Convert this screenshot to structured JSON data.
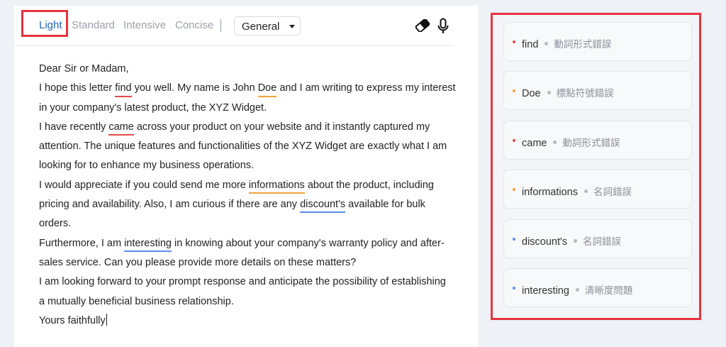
{
  "toolbar": {
    "modes": [
      "Light",
      "Standard",
      "Intensive",
      "Concise"
    ],
    "active_mode": "Light",
    "domain_select": "General"
  },
  "icons": {
    "eraser": "eraser-icon",
    "microphone": "microphone-icon"
  },
  "colors": {
    "accent": "#2563b5",
    "highlight_box": "#e8333f",
    "error_red": "#e5484d",
    "error_orange": "#f1a33a",
    "error_blue": "#5b8def"
  },
  "document": {
    "lines": [
      [
        {
          "t": "Dear Sir or Madam,"
        }
      ],
      [
        {
          "t": "I hope this letter "
        },
        {
          "t": "find",
          "e": "red"
        },
        {
          "t": " you well. My name is John "
        },
        {
          "t": "Doe",
          "e": "orange"
        },
        {
          "t": " and I am writing to express my interest"
        }
      ],
      [
        {
          "t": "in your company's latest product, the XYZ Widget."
        }
      ],
      [
        {
          "t": "I have recently "
        },
        {
          "t": "came",
          "e": "red"
        },
        {
          "t": " across your product on your website and it instantly captured my"
        }
      ],
      [
        {
          "t": "attention. The unique features and functionalities of the XYZ Widget are exactly what I am"
        }
      ],
      [
        {
          "t": "looking for to enhance my business operations."
        }
      ],
      [
        {
          "t": "I would appreciate if you could send me more "
        },
        {
          "t": "informations",
          "e": "orange"
        },
        {
          "t": " about the product, including"
        }
      ],
      [
        {
          "t": "pricing and availability. Also, I am curious if there are any "
        },
        {
          "t": "discount's",
          "e": "blue"
        },
        {
          "t": " available for bulk"
        }
      ],
      [
        {
          "t": "orders."
        }
      ],
      [
        {
          "t": "Furthermore, I am "
        },
        {
          "t": "interesting",
          "e": "blue"
        },
        {
          "t": " in knowing about your company's warranty policy and after-"
        }
      ],
      [
        {
          "t": "sales service. Can you please provide more details on these matters?"
        }
      ],
      [
        {
          "t": "I am looking forward to your prompt response and anticipate the possibility of establishing"
        }
      ],
      [
        {
          "t": "a mutually beneficial business relationship."
        }
      ],
      [
        {
          "t": "Yours faithfully"
        }
      ]
    ]
  },
  "suggestions": [
    {
      "word": "find",
      "type": "動詞形式錯誤",
      "severity": "red"
    },
    {
      "word": "Doe",
      "type": "標點符號錯誤",
      "severity": "orange"
    },
    {
      "word": "came",
      "type": "動詞形式錯誤",
      "severity": "red"
    },
    {
      "word": "informations",
      "type": "名詞錯誤",
      "severity": "orange"
    },
    {
      "word": "discount's",
      "type": "名詞錯誤",
      "severity": "blue"
    },
    {
      "word": "interesting",
      "type": "清晰度問題",
      "severity": "blue"
    }
  ]
}
